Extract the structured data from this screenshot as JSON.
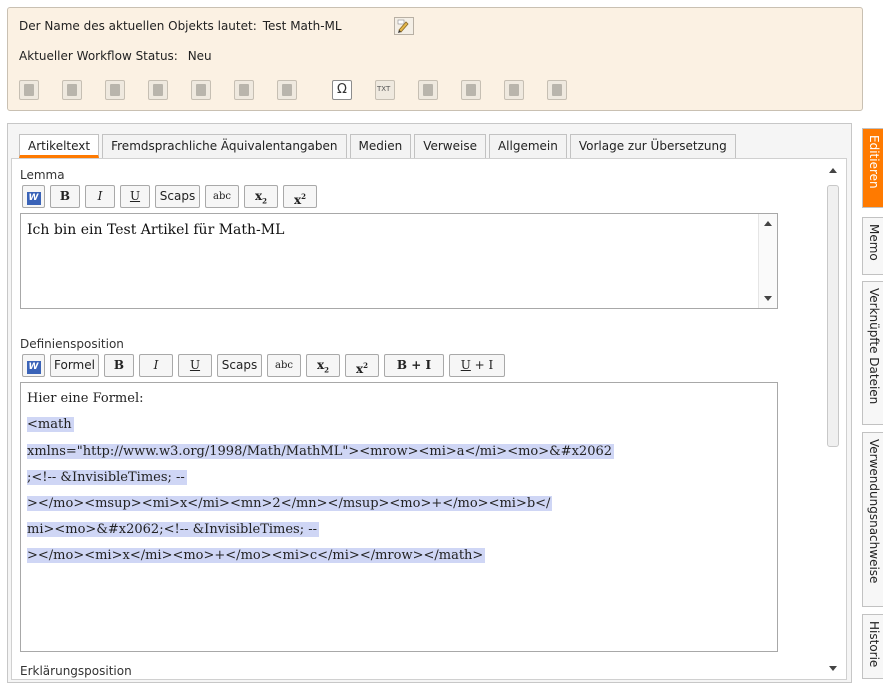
{
  "header": {
    "object_label": "Der Name des aktuellen Objekts lautet:",
    "object_name": "Test Math-ML",
    "status_label": "Aktueller Workflow Status:",
    "status_value": "Neu",
    "toolbar_icons": [
      "article-icon",
      "new-document-icon",
      "copy-document-icon",
      "delete-document-icon",
      "folder-icon",
      "save-icon",
      "sync-icon",
      "omega-icon",
      "txt-icon",
      "book-icon",
      "export-icon",
      "print-icon",
      "link-icon"
    ]
  },
  "tabs": [
    {
      "label": "Artikeltext"
    },
    {
      "label": "Fremdsprachliche Äquivalentangaben"
    },
    {
      "label": "Medien"
    },
    {
      "label": "Verweise"
    },
    {
      "label": "Allgemein"
    },
    {
      "label": "Vorlage zur Übersetzung"
    }
  ],
  "lemma": {
    "label": "Lemma",
    "buttons": {
      "word": "W",
      "bold": "B",
      "italic": "I",
      "underline": "U",
      "scaps": "Scaps",
      "abc": "abc",
      "sub": "x",
      "sub_mark": "2",
      "sup": "x",
      "sup_mark": "2"
    },
    "text": "Ich bin ein Test Artikel für Math-ML"
  },
  "definition": {
    "label": "Definiensposition",
    "buttons": {
      "word": "W",
      "formel": "Formel",
      "bold": "B",
      "italic": "I",
      "underline": "U",
      "scaps": "Scaps",
      "abc": "abc",
      "sub": "x",
      "sub_mark": "2",
      "sup": "x",
      "sup_mark": "2",
      "bi": "B + I",
      "ui_u": "U",
      "ui_rest": " + I"
    },
    "lines": [
      "Hier eine Formel:",
      "<math",
      "xmlns=\"http://www.w3.org/1998/Math/MathML\"><mrow><mi>a</mi><mo>&#x2062",
      ";<!-- &InvisibleTimes; --",
      "></mo><msup><mi>x</mi><mn>2</mn></msup><mo>+</mo><mi>b</",
      "mi><mo>&#x2062;<!-- &InvisibleTimes; --",
      "></mo><mi>x</mi><mo>+</mo><mi>c</mi></mrow></math>"
    ]
  },
  "explanation": {
    "label": "Erklärungsposition"
  },
  "side_tabs": [
    {
      "label": "Editieren"
    },
    {
      "label": "Memo"
    },
    {
      "label": "Verknüpfte Dateien"
    },
    {
      "label": "Verwendungsnachweise"
    },
    {
      "label": "Historie"
    }
  ],
  "colors": {
    "accent": "#ff7a00",
    "header_bg": "#fbf1e3",
    "highlight": "#cfd6f5"
  }
}
